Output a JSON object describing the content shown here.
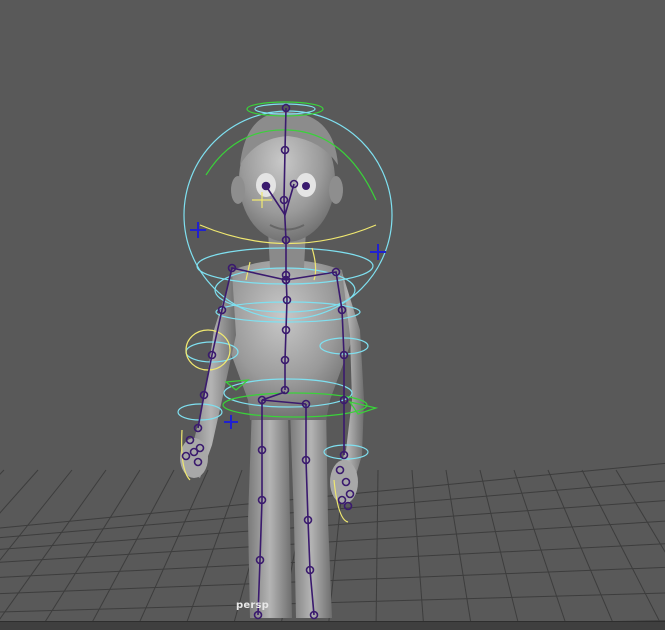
{
  "viewport": {
    "camera_label": "persp",
    "background_color": "#595959",
    "grid_color": "#3c3c3c",
    "model_color": "#9a9a9a",
    "joint_color": "#3a1a6e",
    "control_cyan": "#7fe0f0",
    "control_green": "#3ad23a",
    "control_yellow": "#f0e870",
    "control_blue": "#2020d0"
  }
}
